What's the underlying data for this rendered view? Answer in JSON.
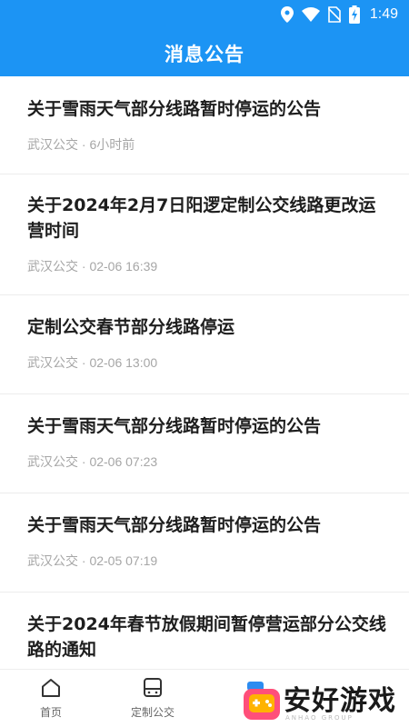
{
  "status_bar": {
    "time": "1:49"
  },
  "header": {
    "title": "消息公告"
  },
  "announcements": [
    {
      "title": "关于雪雨天气部分线路暂时停运的公告",
      "meta": "武汉公交 · 6小时前"
    },
    {
      "title": "关于2024年2月7日阳逻定制公交线路更改运营时间",
      "meta": "武汉公交 · 02-06 16:39"
    },
    {
      "title": "定制公交春节部分线路停运",
      "meta": "武汉公交 · 02-06 13:00"
    },
    {
      "title": "关于雪雨天气部分线路暂时停运的公告",
      "meta": "武汉公交 · 02-06 07:23"
    },
    {
      "title": "关于雪雨天气部分线路暂时停运的公告",
      "meta": "武汉公交 · 02-05 07:19"
    },
    {
      "title": "关于2024年春节放假期间暂停营运部分公交线路的通知",
      "meta": ""
    }
  ],
  "tabs": [
    {
      "label": "首页",
      "icon": "home-icon"
    },
    {
      "label": "定制公交",
      "icon": "bus-icon"
    }
  ],
  "watermark": {
    "text": "安好游戏",
    "sub": "ANHAO GROUP"
  },
  "colors": {
    "primary": "#1c94f4",
    "title_text": "#1e1e1e",
    "meta_text": "#a6a6a6"
  }
}
